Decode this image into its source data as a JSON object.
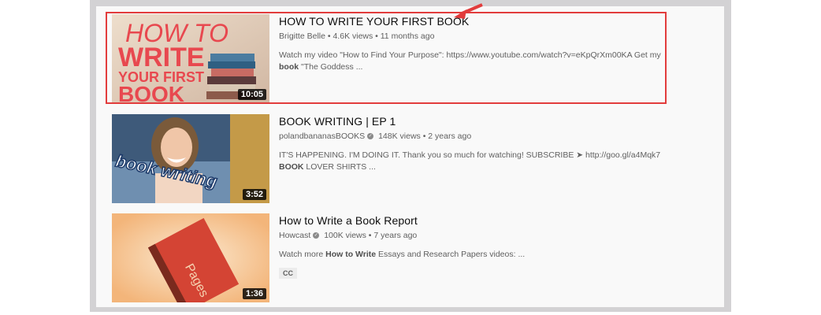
{
  "results": [
    {
      "title": "HOW TO WRITE YOUR FIRST BOOK",
      "channel": "Brigitte Belle",
      "verified": false,
      "stats": "• 4.6K views • 11 months ago",
      "desc_pre": "Watch my video \"How to Find Your Purpose\": https://www.youtube.com/watch?v=eKpQrXm00KA Get my ",
      "desc_bold": "book",
      "desc_post": " \"The Goddess ...",
      "duration": "10:05",
      "thumb_text": [
        "HOW TO",
        "WRITE",
        "YOUR FIRST",
        "BOOK"
      ]
    },
    {
      "title": "BOOK WRITING | EP 1",
      "channel": "polandbananasBOOKS",
      "verified": true,
      "stats": "148K views • 2 years ago",
      "desc_pre": "IT'S HAPPENING. I'M DOING IT. Thank you so much for watching! SUBSCRIBE ➤ http://goo.gl/a4Mqk7 ",
      "desc_bold": "BOOK",
      "desc_post": " LOVER SHIRTS ...",
      "duration": "3:52",
      "thumb_text": "book writing"
    },
    {
      "title": "How to Write a Book Report",
      "channel": "Howcast",
      "verified": true,
      "stats": "100K views • 7 years ago",
      "desc_pre": "Watch more ",
      "desc_bold": "How to Write",
      "desc_post": " Essays and Research Papers videos: ...",
      "badge": "CC",
      "duration": "1:36",
      "thumb_text": "Pages"
    }
  ],
  "colors": {
    "highlight": "#e23c3c",
    "frame": "#d3d2d4",
    "panel": "#f9f9f9"
  }
}
